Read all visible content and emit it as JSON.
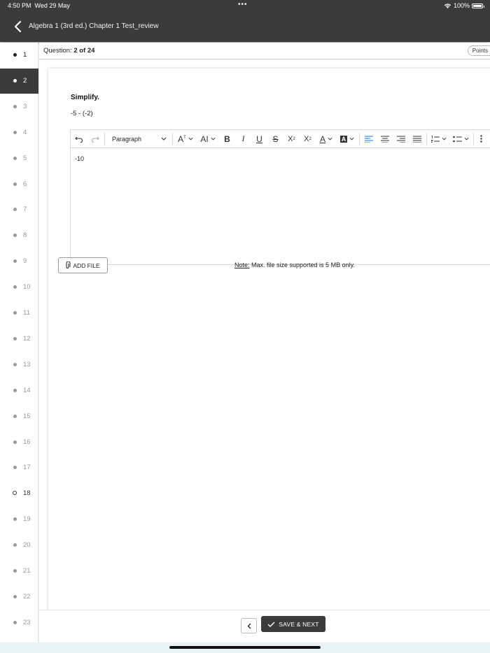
{
  "status_bar": {
    "time": "4:50 PM",
    "date": "Wed 29 May",
    "dots": "•••",
    "battery": "100%"
  },
  "app_bar": {
    "title": "Algebra 1 (3rd ed.) Chapter 1 Test_review"
  },
  "sidebar": {
    "items": [
      {
        "label": "1",
        "state": "answered"
      },
      {
        "label": "2",
        "state": "active"
      },
      {
        "label": "3",
        "state": "unanswered"
      },
      {
        "label": "4",
        "state": "unanswered"
      },
      {
        "label": "5",
        "state": "unanswered"
      },
      {
        "label": "6",
        "state": "unanswered"
      },
      {
        "label": "7",
        "state": "unanswered"
      },
      {
        "label": "8",
        "state": "unanswered"
      },
      {
        "label": "9",
        "state": "unanswered"
      },
      {
        "label": "10",
        "state": "unanswered"
      },
      {
        "label": "11",
        "state": "unanswered"
      },
      {
        "label": "12",
        "state": "unanswered"
      },
      {
        "label": "13",
        "state": "unanswered"
      },
      {
        "label": "14",
        "state": "unanswered"
      },
      {
        "label": "15",
        "state": "unanswered"
      },
      {
        "label": "16",
        "state": "unanswered"
      },
      {
        "label": "17",
        "state": "unanswered"
      },
      {
        "label": "18",
        "state": "open"
      },
      {
        "label": "19",
        "state": "unanswered"
      },
      {
        "label": "20",
        "state": "unanswered"
      },
      {
        "label": "21",
        "state": "unanswered"
      },
      {
        "label": "22",
        "state": "unanswered"
      },
      {
        "label": "23",
        "state": "unanswered"
      }
    ]
  },
  "question_header": {
    "prefix": "Question:",
    "progress": "2 of 24",
    "points_label": "Points"
  },
  "question": {
    "instruction": "Simplify.",
    "expression": "-5 - (-2)"
  },
  "editor": {
    "block_format": "Paragraph",
    "content": "-10",
    "icons": [
      "undo-icon",
      "redo-icon",
      "font-size-icon",
      "font-family-icon",
      "bold-icon",
      "italic-icon",
      "underline-icon",
      "strikethrough-icon",
      "subscript-icon",
      "superscript-icon",
      "font-color-icon",
      "highlight-icon",
      "align-left-icon",
      "align-center-icon",
      "align-right-icon",
      "align-justify-icon",
      "numbered-list-icon",
      "bulleted-list-icon",
      "more-icon"
    ],
    "active_color": "#1a73e8"
  },
  "attachment": {
    "add_file_label": "ADD FILE",
    "note_prefix": "Note:",
    "note_text": " Max. file size supported is 5 MB only."
  },
  "footer": {
    "save_next_label": "SAVE & NEXT"
  },
  "colors": {
    "dark": "#3b3b3b",
    "background": "#e7f3f9"
  }
}
